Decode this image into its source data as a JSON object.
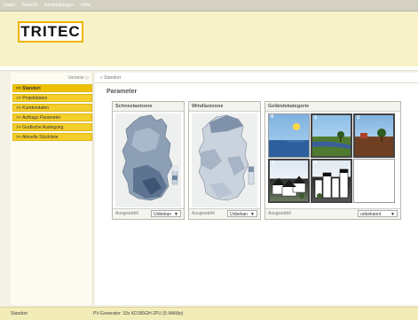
{
  "menu": [
    "Datei",
    "Ansicht",
    "Einstellungen",
    "Hilfe"
  ],
  "logo": "TRITEC",
  "sidebar": {
    "variant_label": "Variante ◇",
    "items": [
      {
        "label": ">> Standort",
        "active": true
      },
      {
        "label": ">> Projektdaten",
        "active": false
      },
      {
        "label": ">> Kundendaten",
        "active": false
      },
      {
        "label": ">> Auftrags Parameter",
        "active": false
      },
      {
        "label": ">> Grafische Auslegung",
        "active": false
      },
      {
        "label": ">> Aktuelle Stückliste",
        "active": false
      }
    ]
  },
  "breadcrumb": "« Standort",
  "page_title": "Parameter",
  "panels": {
    "snow": {
      "title": "Schneelastzone",
      "footer_label": "Ausgewählt",
      "select_value": "Unbekan"
    },
    "wind": {
      "title": "Windlastzone",
      "footer_label": "Ausgewählt",
      "select_value": "Unbekan"
    },
    "terrain": {
      "title": "Geländekategorie",
      "footer_label": "Ausgewählt",
      "select_value": "unbekannt",
      "tiles": [
        "0",
        "1",
        "2",
        "3",
        "4",
        ""
      ]
    }
  },
  "status": {
    "left": "Standort",
    "center": "PV-Generator: 33x KD185GH-2PU (5.94kWp)"
  },
  "colors": {
    "accent": "#f0c000",
    "header_bg": "#f7f2c8",
    "logo_border": "#f0b400"
  }
}
